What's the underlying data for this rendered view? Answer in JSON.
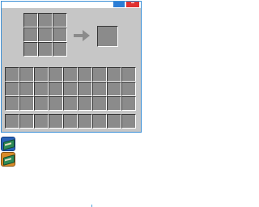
{
  "window": {
    "title": ""
  },
  "crafting": {
    "grid_rows": 3,
    "grid_cols": 3,
    "result": ""
  },
  "inventory": {
    "rows": 3,
    "cols": 9,
    "hotbar_cols": 9
  },
  "tabs": [
    {
      "icon": "book-icon",
      "color": "#2a63b8"
    },
    {
      "icon": "book-icon",
      "color": "#d98b2a"
    }
  ],
  "colors": {
    "panel": "#c6c6c6",
    "slot": "#8b8b8b",
    "border_accent": "#3a8fd6",
    "close_button": "#e03030",
    "minimize_button": "#2b7dd6"
  }
}
